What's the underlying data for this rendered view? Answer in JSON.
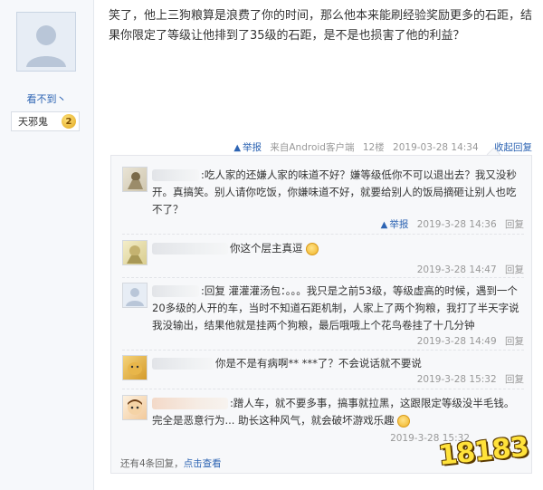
{
  "poster": {
    "username": "看不到丶",
    "level_name": "天邪鬼",
    "level_num": "2"
  },
  "post": {
    "text": "笑了，他上三狗粮算是浪费了你的时间，那么他本来能刷经验奖励更多的石距，结果你限定了等级让他排到了35级的石距，是不是也损害了他的利益？",
    "report": "举报",
    "source": "来自Android客户端",
    "floor": "12楼",
    "time": "2019-03-28 14:34",
    "collapse": "收起回复"
  },
  "replies": [
    {
      "text": ":吃人家的还嫌人家的味道不好？嫌等级低你不可以退出去？我又没秒开。真搞笑。别人请你吃饭，你嫌味道不好，就要给别人的饭局摘砸让别人也吃不了？",
      "report": "举报",
      "time": "2019-3-28 14:36",
      "reply": "回复"
    },
    {
      "text": "你这个层主真逗",
      "time": "2019-3-28 14:47",
      "reply": "回复"
    },
    {
      "text": ":回复 灌灌灌汤包：。。。我只是之前53级，等级虚高的时候，遇到一个20多级的人开的车，当时不知道石距机制，人家上了两个狗粮，我打了半天字说我没输出，结果他就是挂两个狗粮，最后哦哦上个花鸟卷挂了十几分钟",
      "time": "2019-3-28 14:49",
      "reply": "回复"
    },
    {
      "text": "你是不是有病啊** ***了？不会说话就不要说",
      "time": "2019-3-28 15:32",
      "reply": "回复"
    },
    {
      "text": ":蹭人车，就不要多事，搞事就拉黑，这跟限定等级没半毛钱。完全是恶意行为... 助长这种风气，就会破坏游戏乐趣",
      "time": "2019-3-28 15:32",
      "reply": "回复"
    }
  ],
  "more": {
    "prefix": "还有4条回复，",
    "link": "点击查看"
  },
  "watermark": "18183",
  "colors": {
    "link": "#2d64b3",
    "meta": "#999999",
    "lzl_bg": "#f7f8fa"
  }
}
